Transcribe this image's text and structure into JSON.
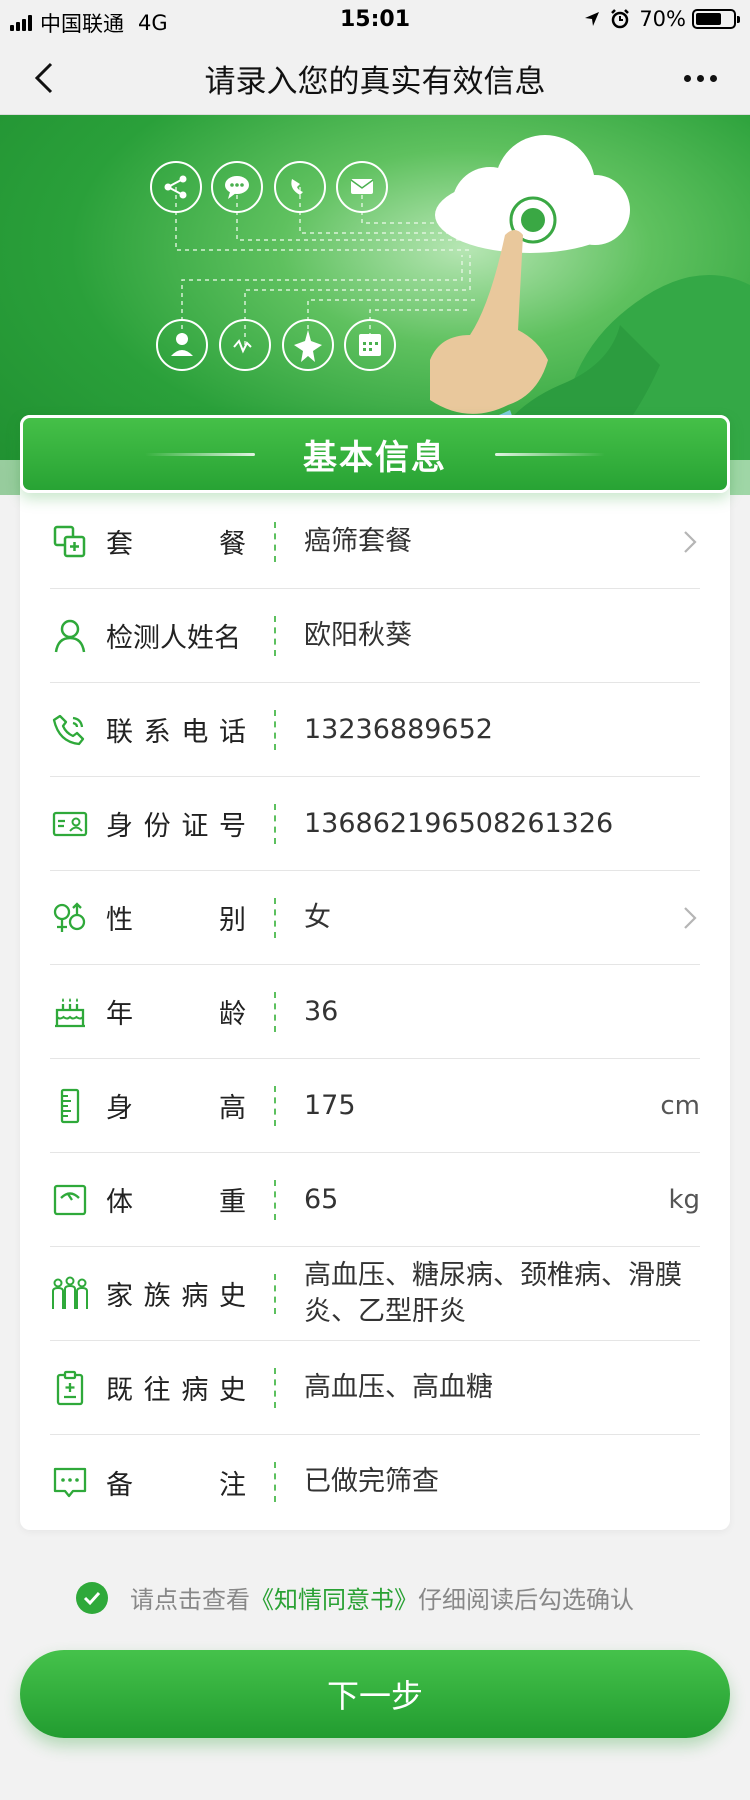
{
  "status_bar": {
    "carrier": "中国联通",
    "network": "4G",
    "time": "15:01",
    "battery": "70%",
    "battery_level": 0.7
  },
  "nav": {
    "title": "请录入您的真实有效信息"
  },
  "card": {
    "title": "基本信息"
  },
  "rows": [
    {
      "icon": "package-icon",
      "label": [
        "套",
        "餐"
      ],
      "value": "癌筛套餐",
      "chevron": true
    },
    {
      "icon": "person-icon",
      "label": [
        "检测人姓名"
      ],
      "value": "欧阳秋葵"
    },
    {
      "icon": "phone-icon",
      "label": [
        "联",
        "系",
        "电",
        "话"
      ],
      "value": "13236889652"
    },
    {
      "icon": "id-card-icon",
      "label": [
        "身",
        "份",
        "证",
        "号"
      ],
      "value": "136862196508261326"
    },
    {
      "icon": "gender-icon",
      "label": [
        "性",
        "别"
      ],
      "value": "女",
      "chevron": true
    },
    {
      "icon": "cake-icon",
      "label": [
        "年",
        "龄"
      ],
      "value": "36"
    },
    {
      "icon": "ruler-icon",
      "label": [
        "身",
        "高"
      ],
      "value": "175",
      "suffix": "cm"
    },
    {
      "icon": "scale-icon",
      "label": [
        "体",
        "重"
      ],
      "value": "65",
      "suffix": "kg"
    },
    {
      "icon": "family-icon",
      "label": [
        "家",
        "族",
        "病",
        "史"
      ],
      "value": "高血压、糖尿病、颈椎病、滑膜炎、乙型肝炎"
    },
    {
      "icon": "clipboard-icon",
      "label": [
        "既",
        "往",
        "病",
        "史"
      ],
      "value": "高血压、高血糖"
    },
    {
      "icon": "chat-icon",
      "label": [
        "备",
        "注"
      ],
      "value": "已做完筛查"
    }
  ],
  "agreement": {
    "prefix": "请点击查看",
    "link": "《知情同意书》",
    "suffix": "仔细阅读后勾选确认",
    "checked": true
  },
  "next_button": "下一步",
  "colors": {
    "accent": "#2fa93a",
    "banner": "#2aa03a"
  }
}
